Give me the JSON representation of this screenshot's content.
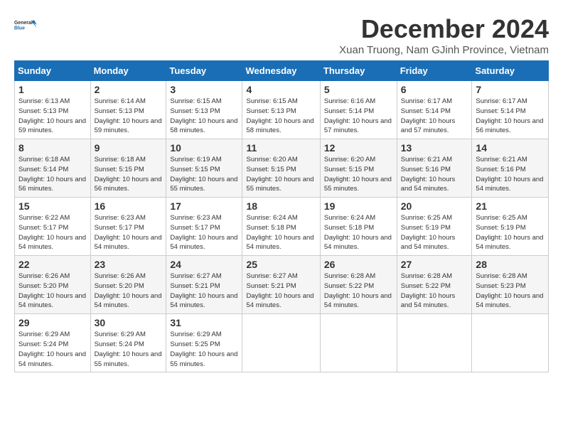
{
  "logo": {
    "line1": "General",
    "line2": "Blue"
  },
  "title": "December 2024",
  "subtitle": "Xuan Truong, Nam GJinh Province, Vietnam",
  "weekdays": [
    "Sunday",
    "Monday",
    "Tuesday",
    "Wednesday",
    "Thursday",
    "Friday",
    "Saturday"
  ],
  "weeks": [
    [
      {
        "day": 1,
        "sunrise": "6:13 AM",
        "sunset": "5:13 PM",
        "daylight": "10 hours and 59 minutes."
      },
      {
        "day": 2,
        "sunrise": "6:14 AM",
        "sunset": "5:13 PM",
        "daylight": "10 hours and 59 minutes."
      },
      {
        "day": 3,
        "sunrise": "6:15 AM",
        "sunset": "5:13 PM",
        "daylight": "10 hours and 58 minutes."
      },
      {
        "day": 4,
        "sunrise": "6:15 AM",
        "sunset": "5:13 PM",
        "daylight": "10 hours and 58 minutes."
      },
      {
        "day": 5,
        "sunrise": "6:16 AM",
        "sunset": "5:14 PM",
        "daylight": "10 hours and 57 minutes."
      },
      {
        "day": 6,
        "sunrise": "6:17 AM",
        "sunset": "5:14 PM",
        "daylight": "10 hours and 57 minutes."
      },
      {
        "day": 7,
        "sunrise": "6:17 AM",
        "sunset": "5:14 PM",
        "daylight": "10 hours and 56 minutes."
      }
    ],
    [
      {
        "day": 8,
        "sunrise": "6:18 AM",
        "sunset": "5:14 PM",
        "daylight": "10 hours and 56 minutes."
      },
      {
        "day": 9,
        "sunrise": "6:18 AM",
        "sunset": "5:15 PM",
        "daylight": "10 hours and 56 minutes."
      },
      {
        "day": 10,
        "sunrise": "6:19 AM",
        "sunset": "5:15 PM",
        "daylight": "10 hours and 55 minutes."
      },
      {
        "day": 11,
        "sunrise": "6:20 AM",
        "sunset": "5:15 PM",
        "daylight": "10 hours and 55 minutes."
      },
      {
        "day": 12,
        "sunrise": "6:20 AM",
        "sunset": "5:15 PM",
        "daylight": "10 hours and 55 minutes."
      },
      {
        "day": 13,
        "sunrise": "6:21 AM",
        "sunset": "5:16 PM",
        "daylight": "10 hours and 54 minutes."
      },
      {
        "day": 14,
        "sunrise": "6:21 AM",
        "sunset": "5:16 PM",
        "daylight": "10 hours and 54 minutes."
      }
    ],
    [
      {
        "day": 15,
        "sunrise": "6:22 AM",
        "sunset": "5:17 PM",
        "daylight": "10 hours and 54 minutes."
      },
      {
        "day": 16,
        "sunrise": "6:23 AM",
        "sunset": "5:17 PM",
        "daylight": "10 hours and 54 minutes."
      },
      {
        "day": 17,
        "sunrise": "6:23 AM",
        "sunset": "5:17 PM",
        "daylight": "10 hours and 54 minutes."
      },
      {
        "day": 18,
        "sunrise": "6:24 AM",
        "sunset": "5:18 PM",
        "daylight": "10 hours and 54 minutes."
      },
      {
        "day": 19,
        "sunrise": "6:24 AM",
        "sunset": "5:18 PM",
        "daylight": "10 hours and 54 minutes."
      },
      {
        "day": 20,
        "sunrise": "6:25 AM",
        "sunset": "5:19 PM",
        "daylight": "10 hours and 54 minutes."
      },
      {
        "day": 21,
        "sunrise": "6:25 AM",
        "sunset": "5:19 PM",
        "daylight": "10 hours and 54 minutes."
      }
    ],
    [
      {
        "day": 22,
        "sunrise": "6:26 AM",
        "sunset": "5:20 PM",
        "daylight": "10 hours and 54 minutes."
      },
      {
        "day": 23,
        "sunrise": "6:26 AM",
        "sunset": "5:20 PM",
        "daylight": "10 hours and 54 minutes."
      },
      {
        "day": 24,
        "sunrise": "6:27 AM",
        "sunset": "5:21 PM",
        "daylight": "10 hours and 54 minutes."
      },
      {
        "day": 25,
        "sunrise": "6:27 AM",
        "sunset": "5:21 PM",
        "daylight": "10 hours and 54 minutes."
      },
      {
        "day": 26,
        "sunrise": "6:28 AM",
        "sunset": "5:22 PM",
        "daylight": "10 hours and 54 minutes."
      },
      {
        "day": 27,
        "sunrise": "6:28 AM",
        "sunset": "5:22 PM",
        "daylight": "10 hours and 54 minutes."
      },
      {
        "day": 28,
        "sunrise": "6:28 AM",
        "sunset": "5:23 PM",
        "daylight": "10 hours and 54 minutes."
      }
    ],
    [
      {
        "day": 29,
        "sunrise": "6:29 AM",
        "sunset": "5:24 PM",
        "daylight": "10 hours and 54 minutes."
      },
      {
        "day": 30,
        "sunrise": "6:29 AM",
        "sunset": "5:24 PM",
        "daylight": "10 hours and 55 minutes."
      },
      {
        "day": 31,
        "sunrise": "6:29 AM",
        "sunset": "5:25 PM",
        "daylight": "10 hours and 55 minutes."
      },
      null,
      null,
      null,
      null
    ]
  ]
}
